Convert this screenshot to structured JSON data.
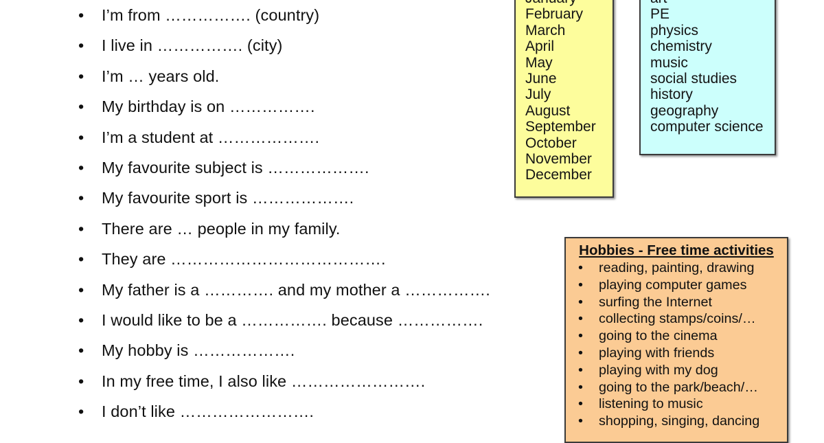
{
  "colors": {
    "months_panel_bg": "#fdfd9c",
    "subjects_panel_bg": "#ccfffc",
    "hobbies_panel_bg": "#fbcb94",
    "panel_border": "#3a3a3a",
    "text": "#111111"
  },
  "bullet_glyph": "•",
  "worksheet": {
    "items": [
      "I’m from ……………. (country)",
      "I live in ……………. (city)",
      "I’m  …  years old.",
      "My birthday is on …………….",
      "I’m a student at ……………….",
      "My favourite subject is ……………….",
      "My favourite sport is ……………….",
      "There are … people in my family.",
      "They are ………………………………….",
      "My father is a …………. and my mother a …………….",
      "I would like to be a ……………. because …………….",
      "My hobby is ……………….",
      "In my free time, I also like …………………….",
      "I don’t like ……………………."
    ]
  },
  "months": {
    "items": [
      "January",
      "February",
      "March",
      "April",
      "May",
      "June",
      "July",
      "August",
      "September",
      "October",
      "November",
      "December"
    ]
  },
  "subjects": {
    "items": [
      "art",
      "PE",
      "physics",
      "chemistry",
      "music",
      "social studies",
      "history",
      "geography",
      "computer science"
    ]
  },
  "hobbies": {
    "title": "Hobbies - Free time activities",
    "items": [
      "reading, painting, drawing",
      "playing computer games",
      "surfing the Internet",
      "collecting stamps/coins/…",
      "going to the cinema",
      "playing with friends",
      "playing with my dog",
      "going to the park/beach/…",
      "listening to music",
      "shopping, singing, dancing"
    ]
  }
}
